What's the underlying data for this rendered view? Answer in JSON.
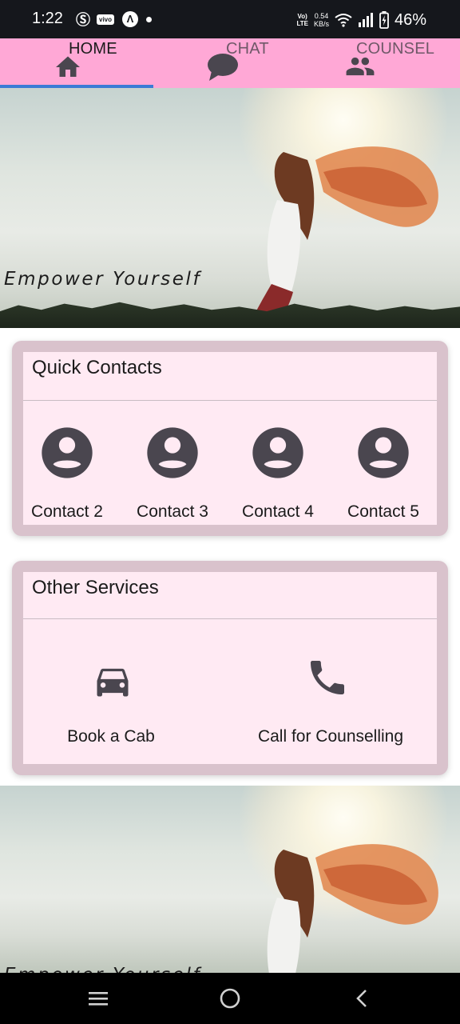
{
  "status_bar": {
    "time": "1:22",
    "left_icons": [
      "s-icon",
      "vivo-icon",
      "a-icon",
      "notification-dot"
    ],
    "volte": [
      "Vo)",
      "LTE"
    ],
    "net_speed_value": "0.54",
    "net_speed_unit": "KB/s",
    "battery_percent": "46%"
  },
  "tabs": [
    {
      "label": "HOME",
      "icon": "home-icon",
      "selected": true
    },
    {
      "label": "CHAT",
      "icon": "chat-bubble-icon",
      "selected": false
    },
    {
      "label": "COUNSEL",
      "icon": "people-icon",
      "selected": false
    }
  ],
  "hero": {
    "caption": "Empower Yourself",
    "second_caption": "Empower Yourself"
  },
  "quick_contacts": {
    "title": "Quick Contacts",
    "contacts": [
      {
        "label": "Contact 2",
        "icon": "account-circle-icon"
      },
      {
        "label": "Contact 3",
        "icon": "account-circle-icon"
      },
      {
        "label": "Contact 4",
        "icon": "account-circle-icon"
      },
      {
        "label": "Contact 5",
        "icon": "account-circle-icon"
      }
    ]
  },
  "other_services": {
    "title": "Other Services",
    "services": [
      {
        "label": "Book a Cab",
        "icon": "car-icon"
      },
      {
        "label": "Call for Counselling",
        "icon": "phone-icon"
      }
    ]
  },
  "navbar": {
    "buttons": [
      "menu-icon",
      "home-circle-icon",
      "back-icon"
    ]
  },
  "colors": {
    "tab_bar": "#ffa8d6",
    "tab_indicator": "#3a7bd5",
    "card_border": "#d9c2cc",
    "card_fill": "#ffeaf3",
    "icon_dark": "#4a464f",
    "status_bar": "#15171c"
  }
}
